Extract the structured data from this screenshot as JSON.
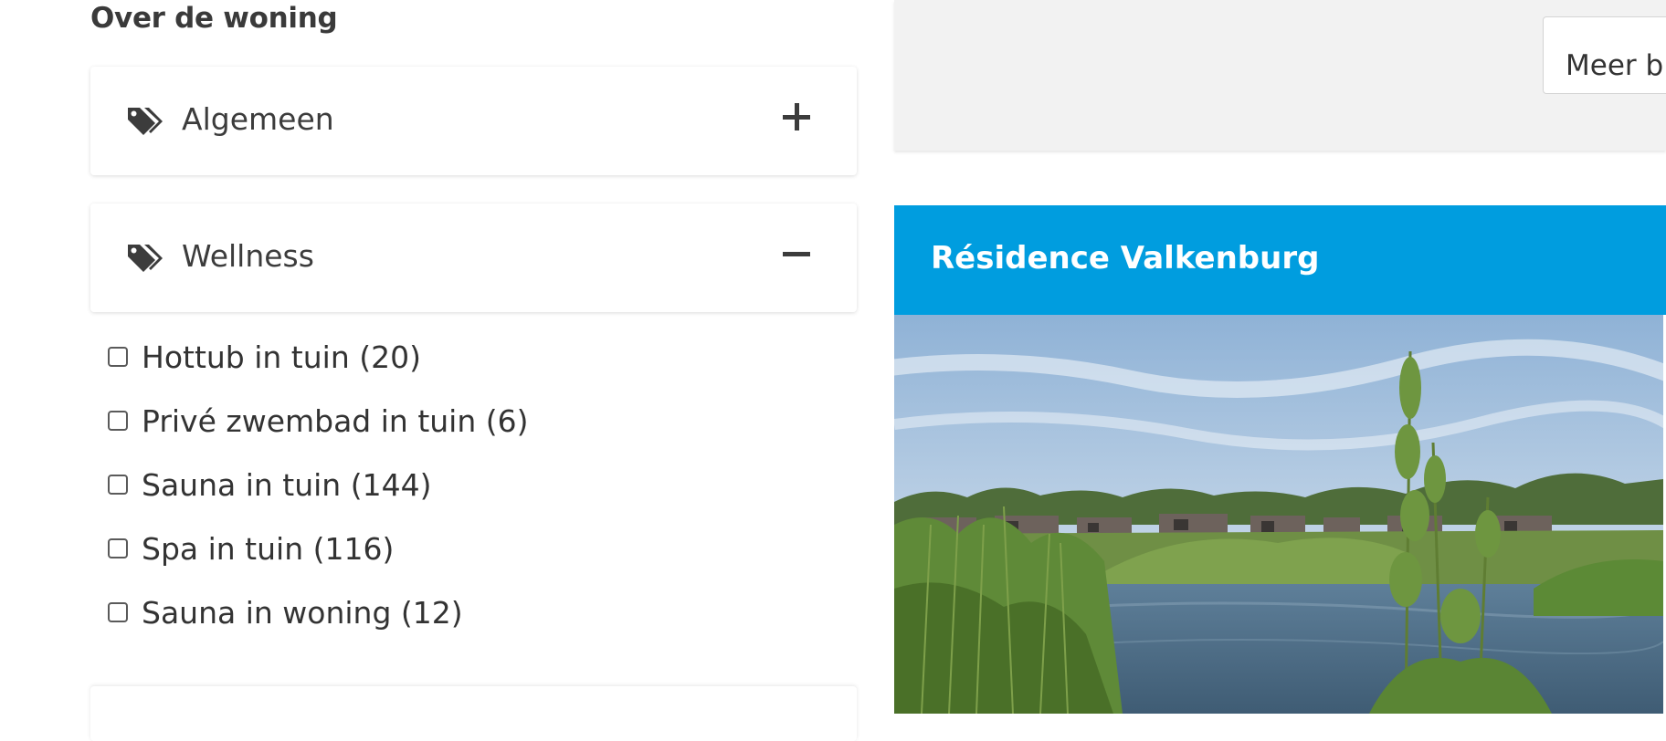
{
  "filters": {
    "section_title": "Over de woning",
    "groups": [
      {
        "label": "Algemeen",
        "icon": "tags-icon",
        "toggle_icon": "plus-icon",
        "expanded": false
      },
      {
        "label": "Wellness",
        "icon": "tags-icon",
        "toggle_icon": "minus-icon",
        "expanded": true
      }
    ],
    "wellness_options": [
      {
        "label": "Hottub in tuin (20)",
        "checked": false
      },
      {
        "label": "Privé zwembad in tuin (6)",
        "checked": false
      },
      {
        "label": "Sauna in tuin (144)",
        "checked": false
      },
      {
        "label": "Spa in tuin (116)",
        "checked": false
      },
      {
        "label": "Sauna in woning (12)",
        "checked": false
      }
    ]
  },
  "toolbar": {
    "more_button_label": "Meer b"
  },
  "result": {
    "title": "Résidence Valkenburg",
    "header_color": "#009ddf",
    "photo_description_icon": "landscape-photo"
  }
}
